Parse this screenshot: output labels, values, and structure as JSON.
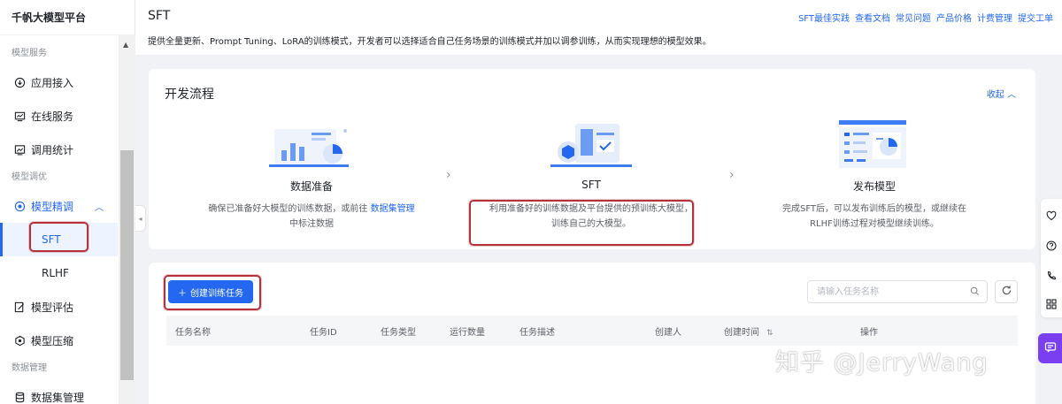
{
  "sidebar": {
    "brand": "千帆大模型平台",
    "groups": {
      "model_service": "模型服务",
      "model_tuning": "模型调优",
      "data_management": "数据管理"
    },
    "items": {
      "app_access": "应用接入",
      "online_service": "在线服务",
      "usage_stats": "调用统计",
      "fine_tuning": "模型精调",
      "sft": "SFT",
      "rlhf": "RLHF",
      "model_eval": "模型评估",
      "model_compress": "模型压缩",
      "dataset_mgmt": "数据集管理"
    }
  },
  "header": {
    "title": "SFT",
    "description": "提供全量更新、Prompt Tuning、LoRA的训练模式，开发者可以选择适合自己任务场景的训练模式并加以调参训练，从而实现理想的模型效果。",
    "links": [
      "SFT最佳实践",
      "查看文档",
      "常见问题",
      "产品价格",
      "计费管理",
      "提交工单"
    ]
  },
  "flow": {
    "title": "开发流程",
    "collapse_label": "收起 ︿",
    "steps": [
      {
        "title": "数据准备",
        "desc_pre": "确保已准备好大模型的训练数据，或前往",
        "desc_link": "数据集管理",
        "desc_post": "中标注数据"
      },
      {
        "title": "SFT",
        "desc_line1": "利用准备好的训练数据及平台提供的预训练大模型，",
        "desc_line2": "训练自己的大模型。"
      },
      {
        "title": "发布模型",
        "desc_line1": "完成SFT后，可以发布训练后的模型，或继续在",
        "desc_line2": "RLHF训练过程对模型继续训练。"
      }
    ]
  },
  "tasks": {
    "create_label": "创建训练任务",
    "search_placeholder": "请输入任务名称",
    "columns": [
      "任务名称",
      "任务ID",
      "任务类型",
      "运行数量",
      "任务描述",
      "创建人",
      "创建时间",
      "操作"
    ]
  },
  "watermark": "知乎 @JerryWang",
  "colors": {
    "accent": "#2468f2",
    "highlight_box": "#b5323a",
    "chat_fab": "#7b3ff2"
  }
}
